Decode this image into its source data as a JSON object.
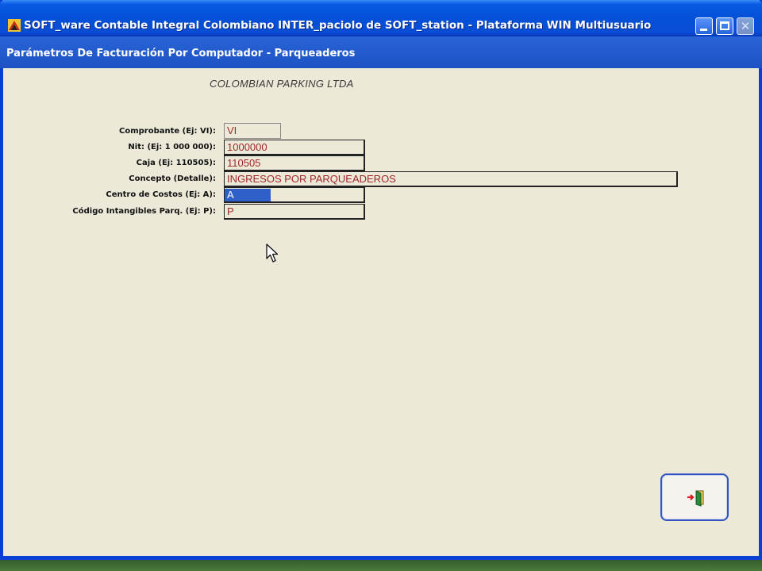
{
  "window": {
    "title": "SOFT_ware Contable Integral Colombiano INTER_paciolo de SOFT_station - Plataforma WIN Multiusuario",
    "subtitle": "Parámetros De Facturación Por Computador - Parqueaderos"
  },
  "company": "COLOMBIAN PARKING LTDA",
  "fields": {
    "comprobante": {
      "label": "Comprobante (Ej: VI):",
      "value": "VI"
    },
    "nit": {
      "label": "Nit: (Ej: 1 000 000):",
      "value": "1000000"
    },
    "caja": {
      "label": "Caja (Ej: 110505):",
      "value": "110505"
    },
    "concepto": {
      "label": "Concepto (Detalle):",
      "value": "INGRESOS POR PARQUEADEROS"
    },
    "centro_costos": {
      "label": "Centro de Costos (Ej: A):",
      "value": "A"
    },
    "codigo_intangibles": {
      "label": "Código Intangibles Parq. (Ej: P):",
      "value": "P"
    }
  },
  "icons": {
    "app": "app-logo-icon",
    "exit": "exit-door-icon",
    "cursor": "mouse-pointer-icon"
  },
  "colors": {
    "titlebar": "#0450d8",
    "field_text": "#a0282a",
    "selection": "#2f5fc8",
    "background": "#ece9d8"
  }
}
